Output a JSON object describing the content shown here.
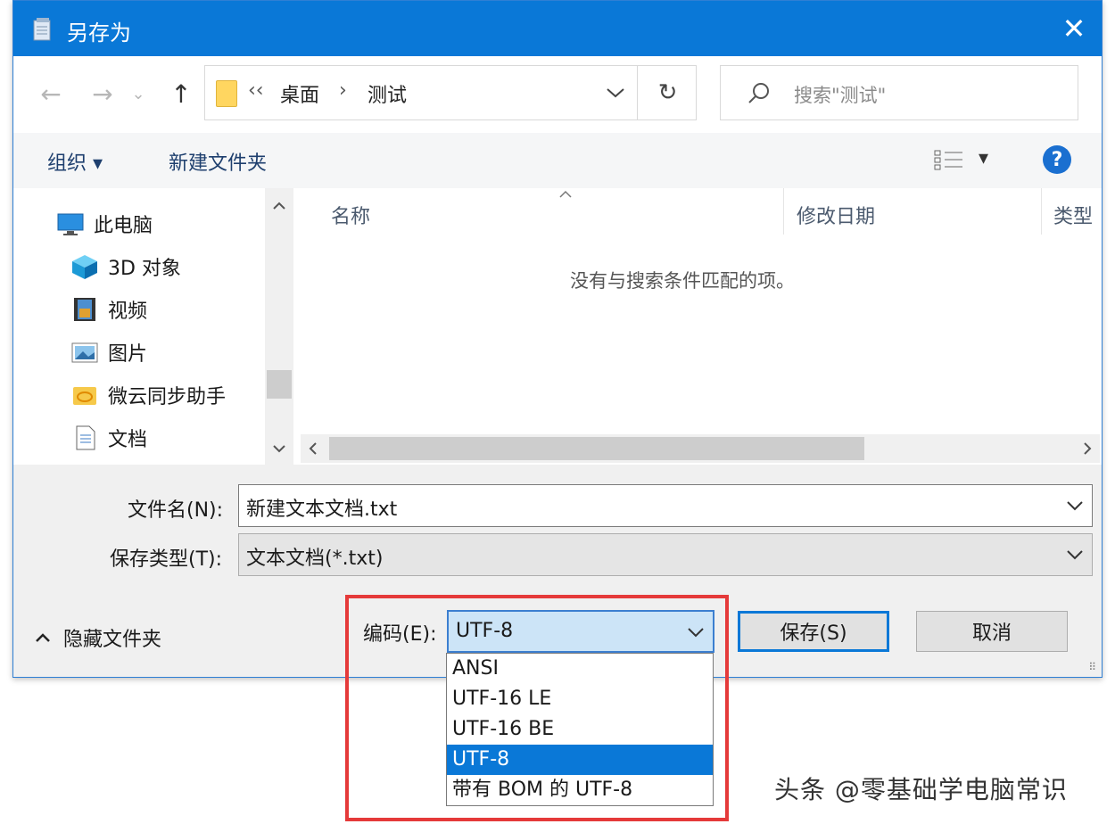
{
  "window": {
    "title": "另存为",
    "close_symbol": "✕"
  },
  "nav": {
    "back_symbol": "←",
    "forward_symbol": "→",
    "recent_symbol": "⌄",
    "up_symbol": "↑",
    "address": {
      "chevrons": "‹‹",
      "path": [
        "桌面",
        "测试"
      ],
      "separator": "›"
    },
    "refresh_symbol": "↻",
    "search_placeholder": "搜索\"测试\""
  },
  "commands": {
    "organize": "组织 ▾",
    "new_folder": "新建文件夹",
    "view_arrow": "▾",
    "help": "?"
  },
  "tree": {
    "items": [
      {
        "label": "此电脑",
        "icon": "computer-icon"
      },
      {
        "label": "3D 对象",
        "icon": "3d-objects-icon"
      },
      {
        "label": "视频",
        "icon": "video-icon"
      },
      {
        "label": "图片",
        "icon": "pictures-icon"
      },
      {
        "label": "微云同步助手",
        "icon": "weiyun-icon"
      },
      {
        "label": "文档",
        "icon": "documents-icon"
      }
    ]
  },
  "files": {
    "columns": [
      "名称",
      "修改日期",
      "类型"
    ],
    "empty_message": "没有与搜索条件匹配的项。"
  },
  "form": {
    "filename_label": "文件名(N):",
    "filename_value": "新建文本文档.txt",
    "type_label": "保存类型(T):",
    "type_value": "文本文档(*.txt)",
    "hide_folders": "隐藏文件夹",
    "encoding_label": "编码(E):",
    "encoding_value": "UTF-8",
    "encoding_options": [
      "ANSI",
      "UTF-16 LE",
      "UTF-16 BE",
      "UTF-8",
      "带有 BOM 的 UTF-8"
    ],
    "encoding_selected_index": 3,
    "save_button": "保存(S)",
    "cancel_button": "取消"
  },
  "watermark": "头条 @零基础学电脑常识",
  "colors": {
    "titlebar": "#0a78d7",
    "highlight": "#0a78d7",
    "annotation": "#e53a3a"
  }
}
